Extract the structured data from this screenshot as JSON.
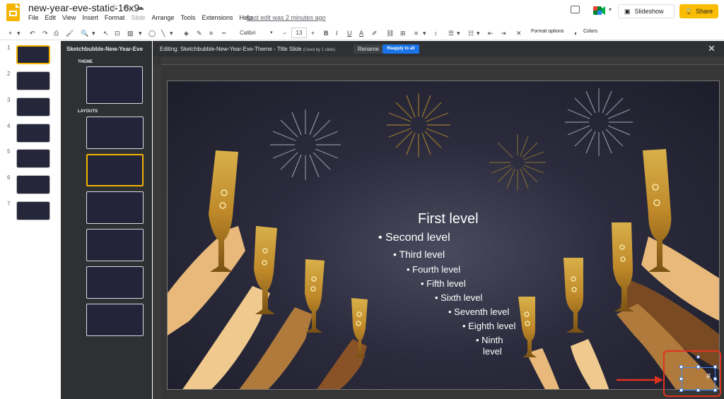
{
  "app": {
    "title": "new-year-eve-static-16x9",
    "menus": [
      "File",
      "Edit",
      "View",
      "Insert",
      "Format",
      "Slide",
      "Arrange",
      "Tools",
      "Extensions",
      "Help"
    ],
    "last_edit": "Last edit was 2 minutes ago",
    "slideshow_label": "Slideshow",
    "share_label": "Share"
  },
  "toolbar": {
    "font": "Calibri",
    "font_size": "13",
    "format_options": "Format options",
    "colors": "Colors"
  },
  "filmstrip": {
    "slides": [
      "1",
      "2",
      "3",
      "4",
      "5",
      "6",
      "7"
    ]
  },
  "layout_panel": {
    "title": "Sketchbubble-New-Year-Eve",
    "theme_label": "THEME",
    "layouts_label": "LAYOUTS"
  },
  "edit_bar": {
    "text": "Editing: Sketchbubble-New-Year-Eve-Theme - Title Slide",
    "used": "(Used by 1 slide)",
    "rename": "Rename",
    "reapply": "Reapply to all"
  },
  "slide": {
    "levels": [
      "First level",
      "Second level",
      "Third level",
      "Fourth level",
      "Fifth level",
      "Sixth level",
      "Seventh level",
      "Eighth level",
      "Ninth",
      "level"
    ],
    "slide_number_placeholder": "#"
  },
  "colors": {
    "accent": "#fbbc04",
    "selection": "#4a86e8",
    "annotation": "#e0321f",
    "reapply": "#1a73e8"
  }
}
